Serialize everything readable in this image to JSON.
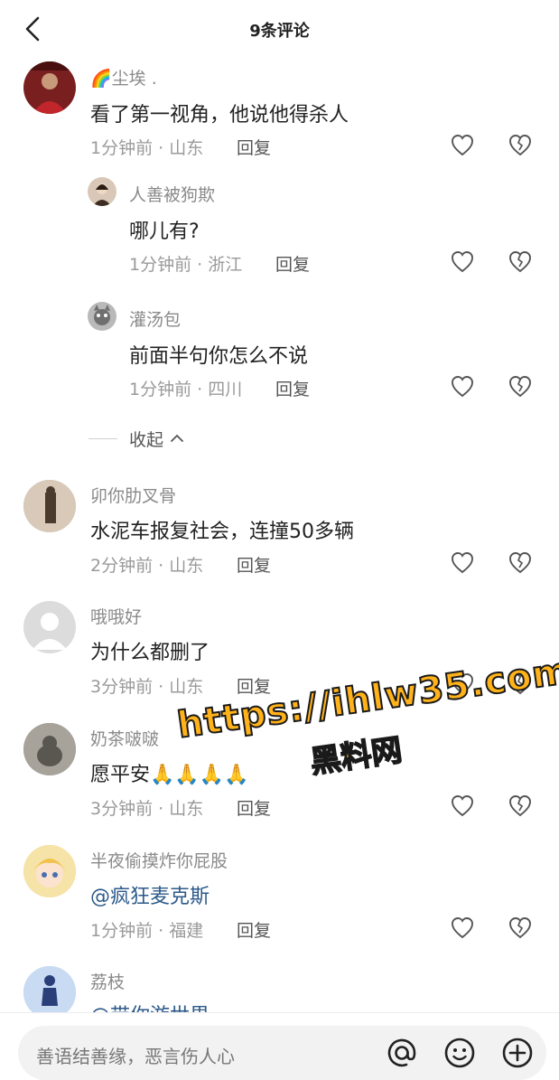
{
  "header": {
    "title": "9条评论"
  },
  "comments": [
    {
      "user": "尘埃 .",
      "text": "看了第一视角，他说他得杀人",
      "time": "1分钟前",
      "location": "山东",
      "reply": "回复"
    },
    {
      "user": "人善被狗欺",
      "text": "哪儿有?",
      "time": "1分钟前",
      "location": "浙江",
      "reply": "回复"
    },
    {
      "user": "灌汤包",
      "text": "前面半句你怎么不说",
      "time": "1分钟前",
      "location": "四川",
      "reply": "回复"
    },
    {
      "user": "卯你肋叉骨",
      "text": "水泥车报复社会，连撞50多辆",
      "time": "2分钟前",
      "location": "山东",
      "reply": "回复"
    },
    {
      "user": "哦哦好",
      "text": "为什么都删了",
      "time": "3分钟前",
      "location": "山东",
      "reply": "回复"
    },
    {
      "user": "奶茶啵啵",
      "text": "愿平安🙏🙏🙏🙏",
      "time": "3分钟前",
      "location": "山东",
      "reply": "回复"
    },
    {
      "user": "半夜偷摸炸你屁股",
      "text": "@疯狂麦克斯",
      "time": "1分钟前",
      "location": "福建",
      "reply": "回复"
    },
    {
      "user": "荔枝",
      "text": "@带你游世界",
      "time": "",
      "location": "",
      "reply": ""
    }
  ],
  "collapse_label": "收起",
  "meta_sep": "·",
  "watermark": {
    "url": "https://ihlw35.com",
    "text": "黑料网"
  },
  "bottom": {
    "placeholder": "善语结善缘，恶言伤人心"
  },
  "icons": {
    "back": "chevron-left-icon",
    "like": "heart-icon",
    "dislike": "broken-heart-icon",
    "at": "at-icon",
    "emoji": "emoji-icon",
    "add": "plus-circle-icon"
  },
  "colors": {
    "watermark": "#ffb21a",
    "mention": "#2d5a8a"
  }
}
